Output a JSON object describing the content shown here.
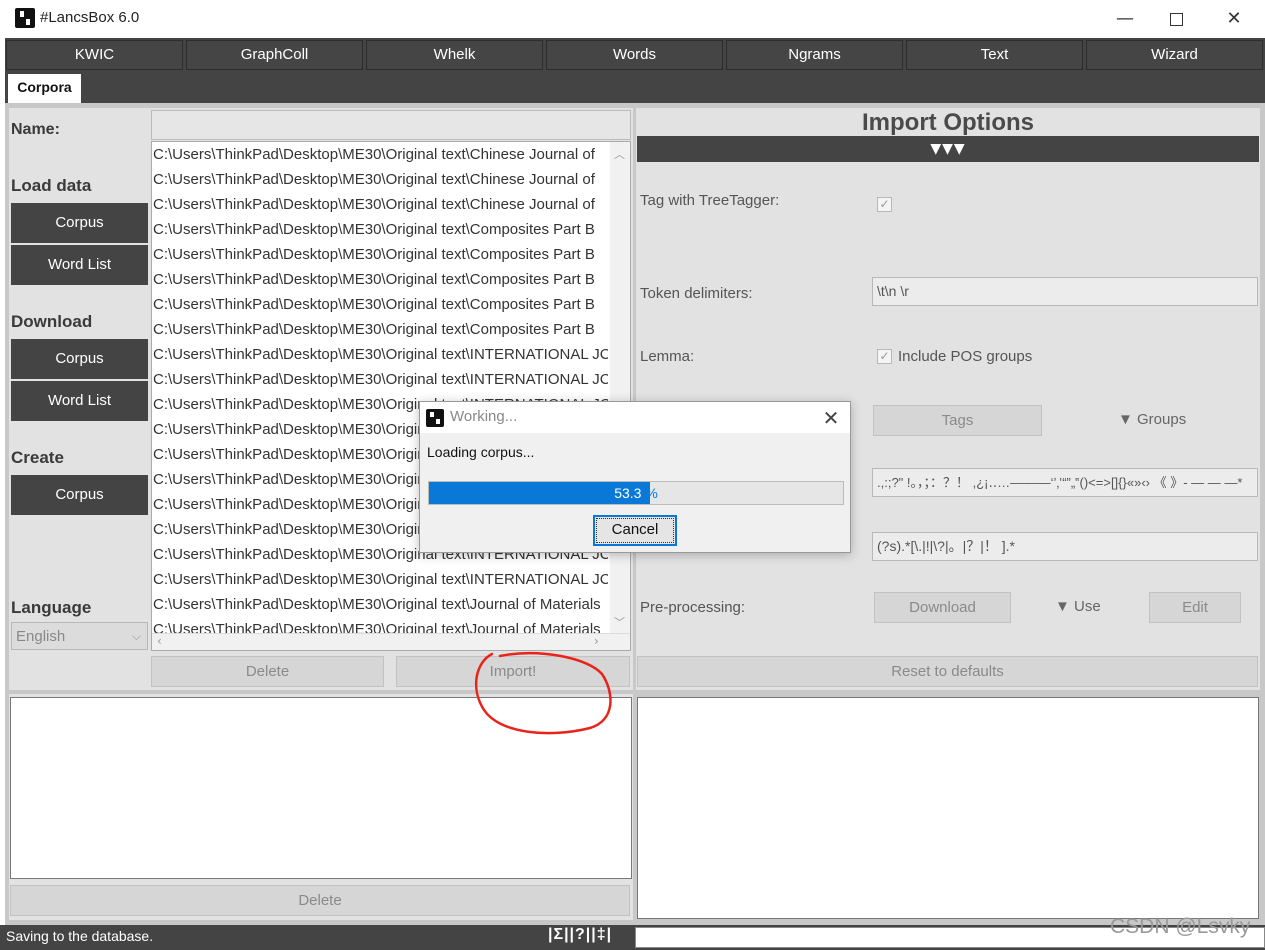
{
  "window": {
    "title": "#LancsBox 6.0",
    "minimize": "—",
    "close": "✕"
  },
  "nav": {
    "tabs": [
      "KWIC",
      "GraphColl",
      "Whelk",
      "Words",
      "Ngrams",
      "Text",
      "Wizard"
    ]
  },
  "subtab": "Corpora",
  "sidebar": {
    "name_label": "Name:",
    "load_data": "Load data",
    "download": "Download",
    "create": "Create",
    "language": "Language",
    "corpus_label": "Corpus",
    "wordlist_label": "Word List",
    "language_value": "English"
  },
  "files": [
    "C:\\Users\\ThinkPad\\Desktop\\ME30\\Original text\\Chinese Journal of",
    "C:\\Users\\ThinkPad\\Desktop\\ME30\\Original text\\Chinese Journal of",
    "C:\\Users\\ThinkPad\\Desktop\\ME30\\Original text\\Chinese Journal of",
    "C:\\Users\\ThinkPad\\Desktop\\ME30\\Original text\\Composites Part B",
    "C:\\Users\\ThinkPad\\Desktop\\ME30\\Original text\\Composites Part B",
    "C:\\Users\\ThinkPad\\Desktop\\ME30\\Original text\\Composites Part B",
    "C:\\Users\\ThinkPad\\Desktop\\ME30\\Original text\\Composites Part B",
    "C:\\Users\\ThinkPad\\Desktop\\ME30\\Original text\\Composites Part B",
    "C:\\Users\\ThinkPad\\Desktop\\ME30\\Original text\\INTERNATIONAL JC",
    "C:\\Users\\ThinkPad\\Desktop\\ME30\\Original text\\INTERNATIONAL JC",
    "C:\\Users\\ThinkPad\\Desktop\\ME30\\Original text\\INTERNATIONAL JC",
    "C:\\Users\\ThinkPad\\Desktop\\ME30\\Original text\\INTERNATIONAL JC",
    "C:\\Users\\ThinkPad\\Desktop\\ME30\\Original text\\INTERNATIONAL JC",
    "C:\\Users\\ThinkPad\\Desktop\\ME30\\Original text\\INTERNATIONAL JC",
    "C:\\Users\\ThinkPad\\Desktop\\ME30\\Original text\\INTERNATIONAL JC",
    "C:\\Users\\ThinkPad\\Desktop\\ME30\\Original text\\INTERNATIONAL JC",
    "C:\\Users\\ThinkPad\\Desktop\\ME30\\Original text\\INTERNATIONAL JC",
    "C:\\Users\\ThinkPad\\Desktop\\ME30\\Original text\\INTERNATIONAL JC",
    "C:\\Users\\ThinkPad\\Desktop\\ME30\\Original text\\Journal of Materials",
    "C:\\Users\\ThinkPad\\Desktop\\ME30\\Original text\\Journal of Materials"
  ],
  "buttons": {
    "delete": "Delete",
    "import": "Import!",
    "reset": "Reset to defaults",
    "tags": "Tags",
    "groups": "▼ Groups",
    "download": "Download",
    "use": "▼ Use",
    "edit": "Edit",
    "bottom_delete": "Delete"
  },
  "import_options": {
    "title": "Import Options",
    "bar": "▼▼▼",
    "tag_label": "Tag with TreeTagger:",
    "token_label": "Token delimiters:",
    "token_value": "\\t\\n \\r",
    "lemma_label": "Lemma:",
    "lemma_check": "Include POS groups",
    "punct_value": ".,:;?\" !。，；：？！ ,¿¡‥…‒–—―‘’‚‛“”„‟()<=>[]{}«»‹› 《 》- — — —*",
    "regex_value": "(?s).*[\\.|!|\\?|。|？|！ ].*",
    "preproc_label": "Pre-processing:",
    "checkmark": "✓"
  },
  "dialog": {
    "title": "Working...",
    "message": "Loading corpus...",
    "progress": 53.3,
    "progress_text": "53.3",
    "progress_pct": " %",
    "cancel": "Cancel",
    "close": "✕"
  },
  "status": {
    "text": "Saving to the database.",
    "icons": "|Σ||?||‡|"
  },
  "watermark": "CSDN @Lsvky",
  "colors": {
    "dark_bar": "#444444",
    "progress_blue": "#0a78d7",
    "annotation_red": "#e8231a"
  }
}
